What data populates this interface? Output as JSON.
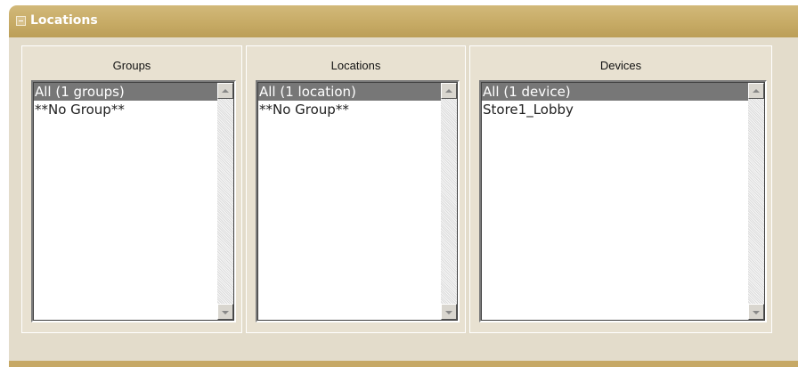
{
  "panel": {
    "title": "Locations"
  },
  "groups": {
    "title": "Groups",
    "items": [
      "All (1 groups)",
      "**No Group**"
    ]
  },
  "locations": {
    "title": "Locations",
    "items": [
      "All (1 location)",
      "**No Group**"
    ]
  },
  "devices": {
    "title": "Devices",
    "items": [
      "All (1 device)",
      "Store1_Lobby"
    ]
  },
  "icons": {
    "collapse": "collapse-icon",
    "scroll_up": "arrow-up-icon",
    "scroll_down": "arrow-down-icon"
  }
}
